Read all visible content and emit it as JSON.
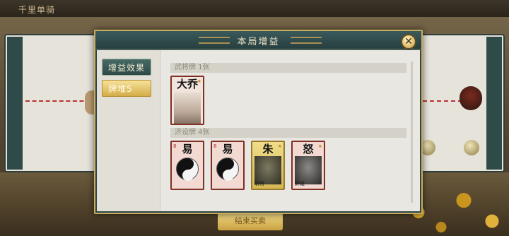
{
  "game": {
    "top_title": "千里单骑"
  },
  "background": {
    "bottom_button": "结束买卖"
  },
  "modal": {
    "title": "本局增益",
    "close_icon": "close-x-icon",
    "tabs": [
      {
        "label": "增益效果",
        "active": false
      },
      {
        "label": "牌堆5",
        "active": true
      }
    ],
    "sections": [
      {
        "label": "武将牌 1张",
        "cards": [
          {
            "text": "大乔",
            "style": "person"
          }
        ]
      },
      {
        "label": "济设牌 4张",
        "cards": [
          {
            "text": "易",
            "style": "yinyang",
            "corner": "8"
          },
          {
            "text": "易",
            "style": "yinyang",
            "corner": "8"
          },
          {
            "text": "朱",
            "style": "gold",
            "foot": "斩将"
          },
          {
            "text": "怒",
            "style": "dark",
            "foot": "奸雄"
          }
        ]
      }
    ]
  },
  "colors": {
    "modal_frame": "#2d4547",
    "modal_border": "#c8ac5e",
    "active_tab": "#d4ac48",
    "card_border": "#7f2f25"
  }
}
